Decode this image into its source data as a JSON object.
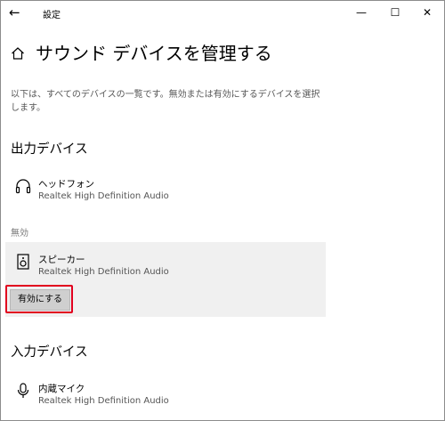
{
  "window": {
    "title": "設定",
    "back_glyph": "←",
    "minimize_glyph": "—",
    "maximize_glyph": "☐",
    "close_glyph": "✕"
  },
  "page": {
    "title": "サウンド デバイスを管理する",
    "description": "以下は、すべてのデバイスの一覧です。無効または有効にするデバイスを選択します。",
    "home_icon": "home-icon"
  },
  "output": {
    "section_title": "出力デバイス",
    "devices": [
      {
        "name": "ヘッドフォン",
        "driver": "Realtek High Definition Audio",
        "icon": "headphones-icon"
      }
    ],
    "disabled_label": "無効",
    "disabled_devices": [
      {
        "name": "スピーカー",
        "driver": "Realtek High Definition Audio",
        "icon": "speaker-icon",
        "button_label": "有効にする"
      }
    ]
  },
  "input": {
    "section_title": "入力デバイス",
    "devices": [
      {
        "name": "内蔵マイク",
        "driver": "Realtek High Definition Audio",
        "icon": "microphone-icon"
      }
    ]
  },
  "colors": {
    "highlight": "#e1001e",
    "panel": "#f0f0f0",
    "button": "#cfcfcf"
  }
}
